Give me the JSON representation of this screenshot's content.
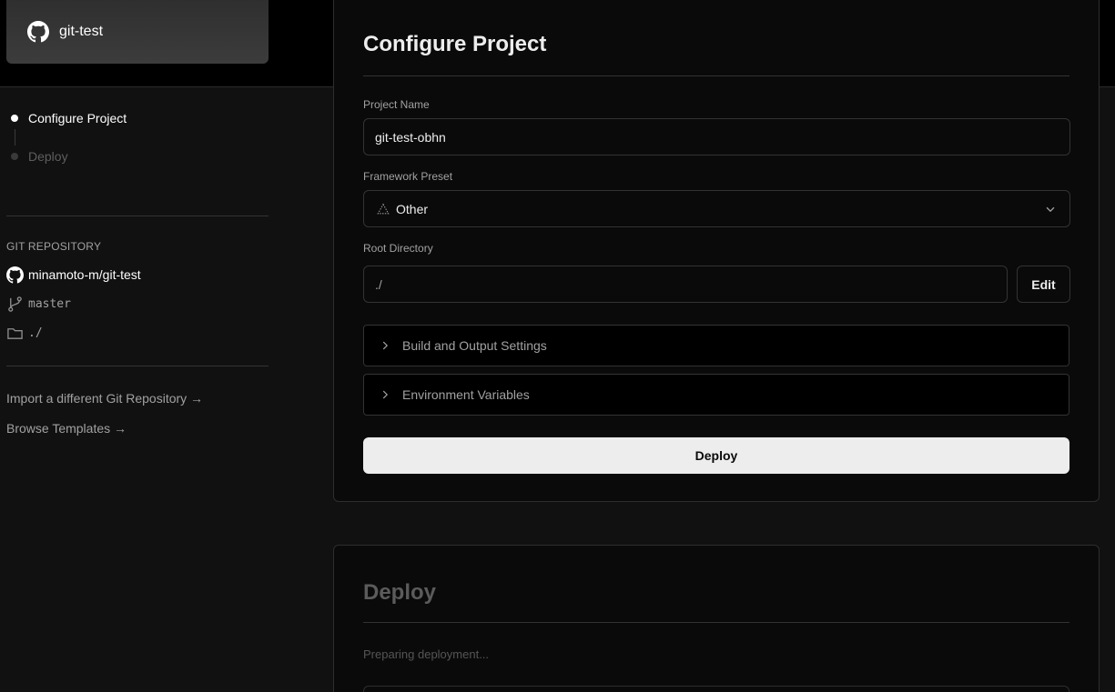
{
  "header": {
    "repo_name": "git-test"
  },
  "steps": [
    {
      "label": "Configure Project",
      "active": true
    },
    {
      "label": "Deploy",
      "active": false
    }
  ],
  "git": {
    "section_title": "GIT REPOSITORY",
    "repo": "minamoto-m/git-test",
    "branch": "master",
    "directory": "./"
  },
  "links": {
    "import_label": "Import a different Git Repository →",
    "templates_label": "Browse Templates →"
  },
  "configure": {
    "title": "Configure Project",
    "project_name_label": "Project Name",
    "project_name_value": "git-test-obhn",
    "framework_label": "Framework Preset",
    "framework_value": "Other",
    "root_dir_label": "Root Directory",
    "root_dir_value": "./",
    "edit_label": "Edit",
    "build_settings_label": "Build and Output Settings",
    "env_vars_label": "Environment Variables",
    "deploy_button_label": "Deploy"
  },
  "deploy_card": {
    "title": "Deploy",
    "status": "Preparing deployment..."
  },
  "colors": {
    "background": "#111111",
    "card": "#0a0a0a",
    "primary_button": "#ededed",
    "muted_text": "#a1a1a1"
  }
}
